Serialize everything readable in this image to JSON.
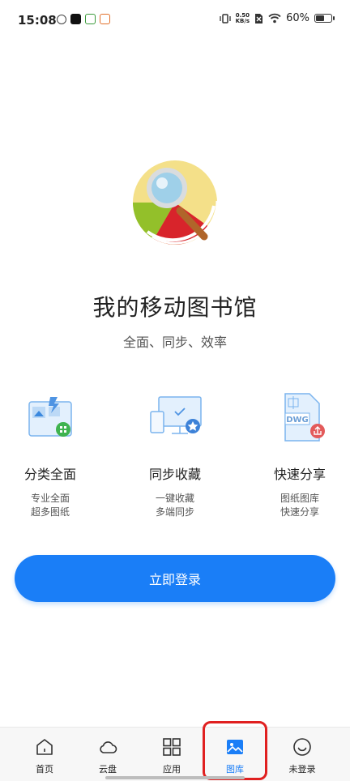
{
  "status_bar": {
    "time": "15:08",
    "net_speed_value": "0.50",
    "net_speed_unit": "KB/s",
    "battery": "60%",
    "battery_level": 0.6
  },
  "hero": {
    "title": "我的移动图书馆",
    "subtitle": "全面、同步、效率"
  },
  "features": [
    {
      "title": "分类全面",
      "desc_line1": "专业全面",
      "desc_line2": "超多图纸"
    },
    {
      "title": "同步收藏",
      "desc_line1": "一键收藏",
      "desc_line2": "多端同步"
    },
    {
      "title": "快速分享",
      "desc_line1": "图纸图库",
      "desc_line2": "快速分享",
      "icon_text": "DWG"
    }
  ],
  "login": {
    "label": "立即登录"
  },
  "bottom_nav": {
    "items": [
      {
        "label": "首页",
        "icon": "home-icon"
      },
      {
        "label": "云盘",
        "icon": "cloud-icon"
      },
      {
        "label": "应用",
        "icon": "apps-icon"
      },
      {
        "label": "图库",
        "icon": "gallery-icon",
        "active": true
      },
      {
        "label": "未登录",
        "icon": "smiley-icon"
      }
    ]
  },
  "colors": {
    "accent": "#1a7ef7",
    "highlight": "#e02020",
    "nav_background": "#f7f7f7"
  }
}
